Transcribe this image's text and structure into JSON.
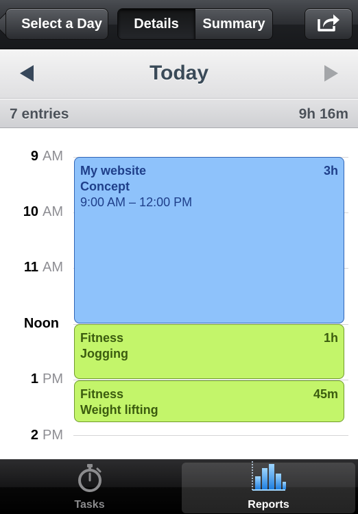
{
  "navbar": {
    "back_label": "Select a Day",
    "segments": [
      "Details",
      "Summary"
    ],
    "active_segment": "Details",
    "share_icon": "share-arrow-icon"
  },
  "day_header": {
    "title": "Today",
    "prev_icon": "triangle-left-icon",
    "next_icon": "triangle-right-icon"
  },
  "summary": {
    "entries": "7 entries",
    "total": "9h 16m"
  },
  "hours": [
    {
      "num": "9",
      "suffix": "AM"
    },
    {
      "num": "10",
      "suffix": "AM"
    },
    {
      "num": "11",
      "suffix": "AM"
    },
    {
      "num": "Noon",
      "suffix": ""
    },
    {
      "num": "1",
      "suffix": "PM"
    },
    {
      "num": "2",
      "suffix": "PM"
    }
  ],
  "events": [
    {
      "project": "My website",
      "task": "Concept",
      "time": "9:00 AM – 12:00 PM",
      "duration": "3h",
      "color": "#8ec2fb"
    },
    {
      "project": "Fitness",
      "task": "Jogging",
      "duration": "1h",
      "color": "#c3f56a"
    },
    {
      "project": "Fitness",
      "task": "Weight lifting",
      "duration": "45m",
      "color": "#c3f56a"
    }
  ],
  "tabs": [
    {
      "label": "Tasks",
      "icon": "stopwatch-icon",
      "selected": false
    },
    {
      "label": "Reports",
      "icon": "bar-chart-icon",
      "selected": true
    }
  ]
}
